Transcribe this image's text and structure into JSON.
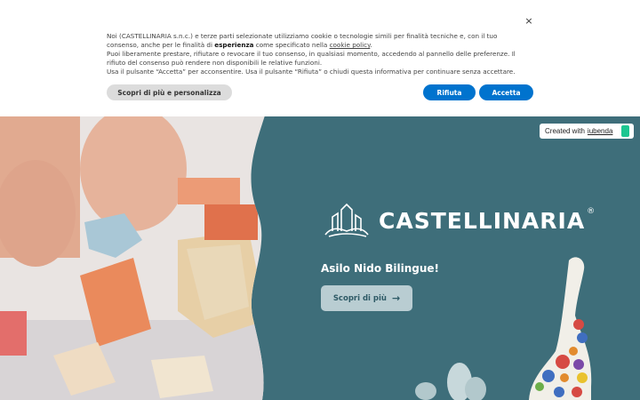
{
  "cookie_banner": {
    "close_icon": "×",
    "text_1": "Noi (CASTELLINARIA s.n.c.) e terze parti selezionate utilizziamo cookie o tecnologie simili per finalità tecniche e, con il tuo",
    "text_2a": "consenso, anche per le finalità di ",
    "text_2b": "esperienza",
    "text_2c": " come specificato nella ",
    "text_2d": "cookie policy",
    "text_2e": ".",
    "text_3": "Puoi liberamente prestare, rifiutare o revocare il tuo consenso, in qualsiasi momento, accedendo al pannello delle preferenze. Il",
    "text_4": "rifiuto del consenso può rendere non disponibili le relative funzioni.",
    "text_5": "Usa il pulsante “Accetta” per acconsentire. Usa il pulsante “Rifiuta” o chiudi questa informativa per continuare senza accettare.",
    "customize_label": "Scopri di più e personalizza",
    "reject_label": "Rifiuta",
    "accept_label": "Accetta"
  },
  "iubenda_badge": {
    "prefix": "Created with",
    "link": "iubenda"
  },
  "hero": {
    "brand_name": "CASTELLINARIA",
    "brand_reg": "®",
    "tagline": "Asilo Nido Bilingue!",
    "cta_label": "Scopri di più",
    "cta_icon": "→"
  },
  "colors": {
    "hero_bg": "#3e6e7a",
    "button_blue": "#0073ce",
    "cta_bg": "#b9cdd2"
  }
}
